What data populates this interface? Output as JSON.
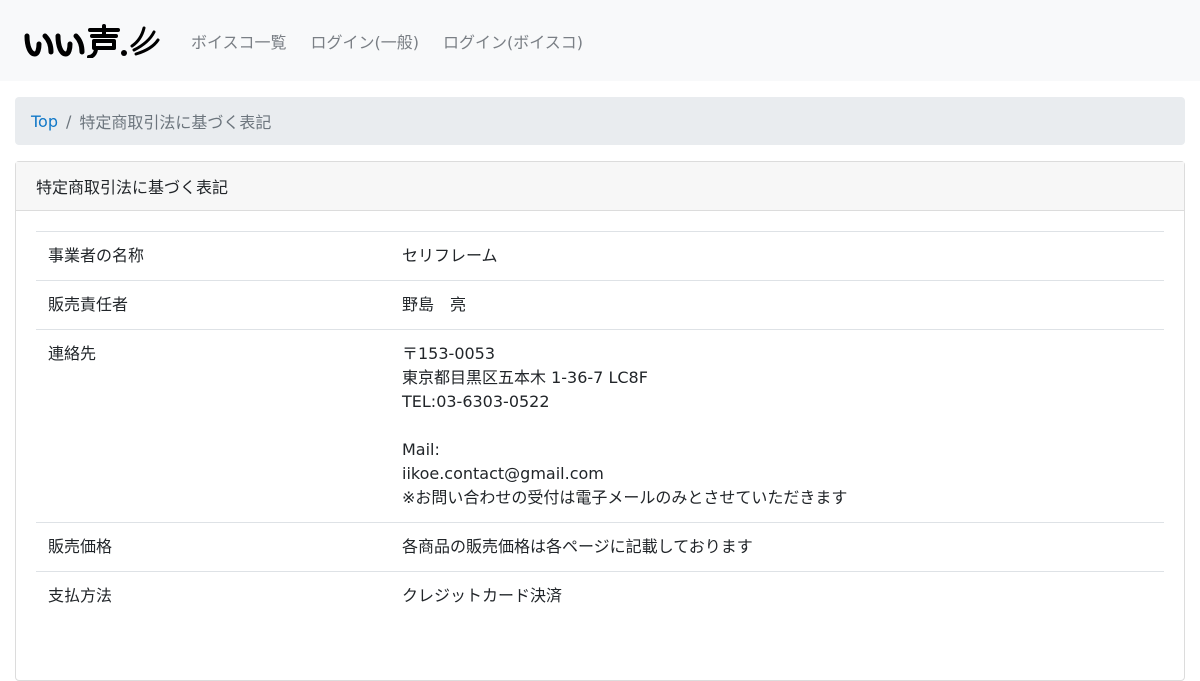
{
  "brand": {
    "logo_text": "いい声"
  },
  "nav": {
    "items": [
      {
        "label": "ボイスコ一覧"
      },
      {
        "label": "ログイン(一般)"
      },
      {
        "label": "ログイン(ボイスコ)"
      }
    ]
  },
  "breadcrumb": {
    "home": "Top",
    "separator": "/",
    "current": "特定商取引法に基づく表記"
  },
  "card": {
    "title": "特定商取引法に基づく表記",
    "rows": [
      {
        "label": "事業者の名称",
        "value_lines": [
          "セリフレーム"
        ]
      },
      {
        "label": "販売責任者",
        "value_lines": [
          "野島　亮"
        ]
      },
      {
        "label": "連絡先",
        "value_lines": [
          "〒153-0053",
          "東京都目黒区五本木 1-36-7 LC8F",
          "TEL:03-6303-0522",
          "",
          "Mail:",
          "iikoe.contact@gmail.com",
          "※お問い合わせの受付は電子メールのみとさせていただきます"
        ]
      },
      {
        "label": "販売価格",
        "value_lines": [
          "各商品の販売価格は各ページに記載しております"
        ]
      },
      {
        "label": "支払方法",
        "value_lines": [
          "クレジットカード決済"
        ]
      }
    ]
  },
  "colors": {
    "navbar_bg": "#f8f9fa",
    "link": "#1178c8",
    "muted": "#6c757d",
    "breadcrumb_bg": "#e9ecef"
  }
}
